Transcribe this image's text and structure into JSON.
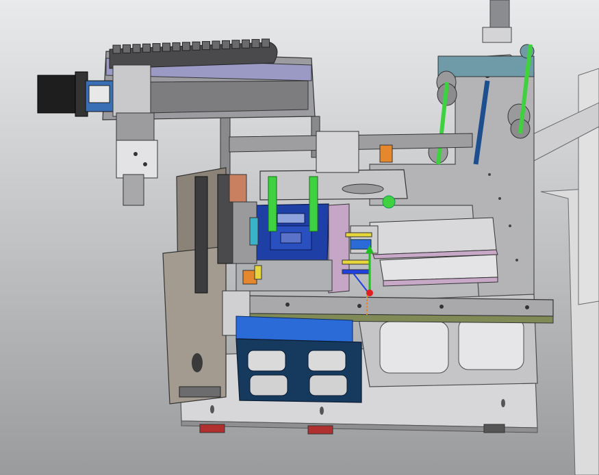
{
  "view": {
    "background_top": "#e9eaec",
    "background_bottom": "#9a9b9d"
  },
  "colors": {
    "frame_gray": "#b9b9bb",
    "frame_dark": "#6b6b6d",
    "cable_chain": "#4a4a4c",
    "slide_purple": "#8f8fb3",
    "motor_black": "#1e1e1e",
    "blue_plate": "#1e3fa6",
    "bright_blue": "#2a6bd8",
    "navy_base": "#163a5e",
    "green_rod": "#3fd13f",
    "dark_blue_rod": "#1d4f8f",
    "olive_strip": "#7f8a56",
    "pink_tray": "#c7a9c7",
    "orange_part": "#e5872c",
    "triad_red": "#e02020",
    "triad_green": "#20c020",
    "triad_blue": "#2040e0"
  },
  "parts": [
    "cable-chain",
    "stepper-motor",
    "linear-module",
    "gripper-head",
    "vertical-lift-frame",
    "top-bracket",
    "blue-fixture-plate",
    "conveyor-rail",
    "feeder-trays",
    "base-plate",
    "right-column",
    "roller-assembly",
    "blue-base-cabinet",
    "coordinate-triad"
  ]
}
